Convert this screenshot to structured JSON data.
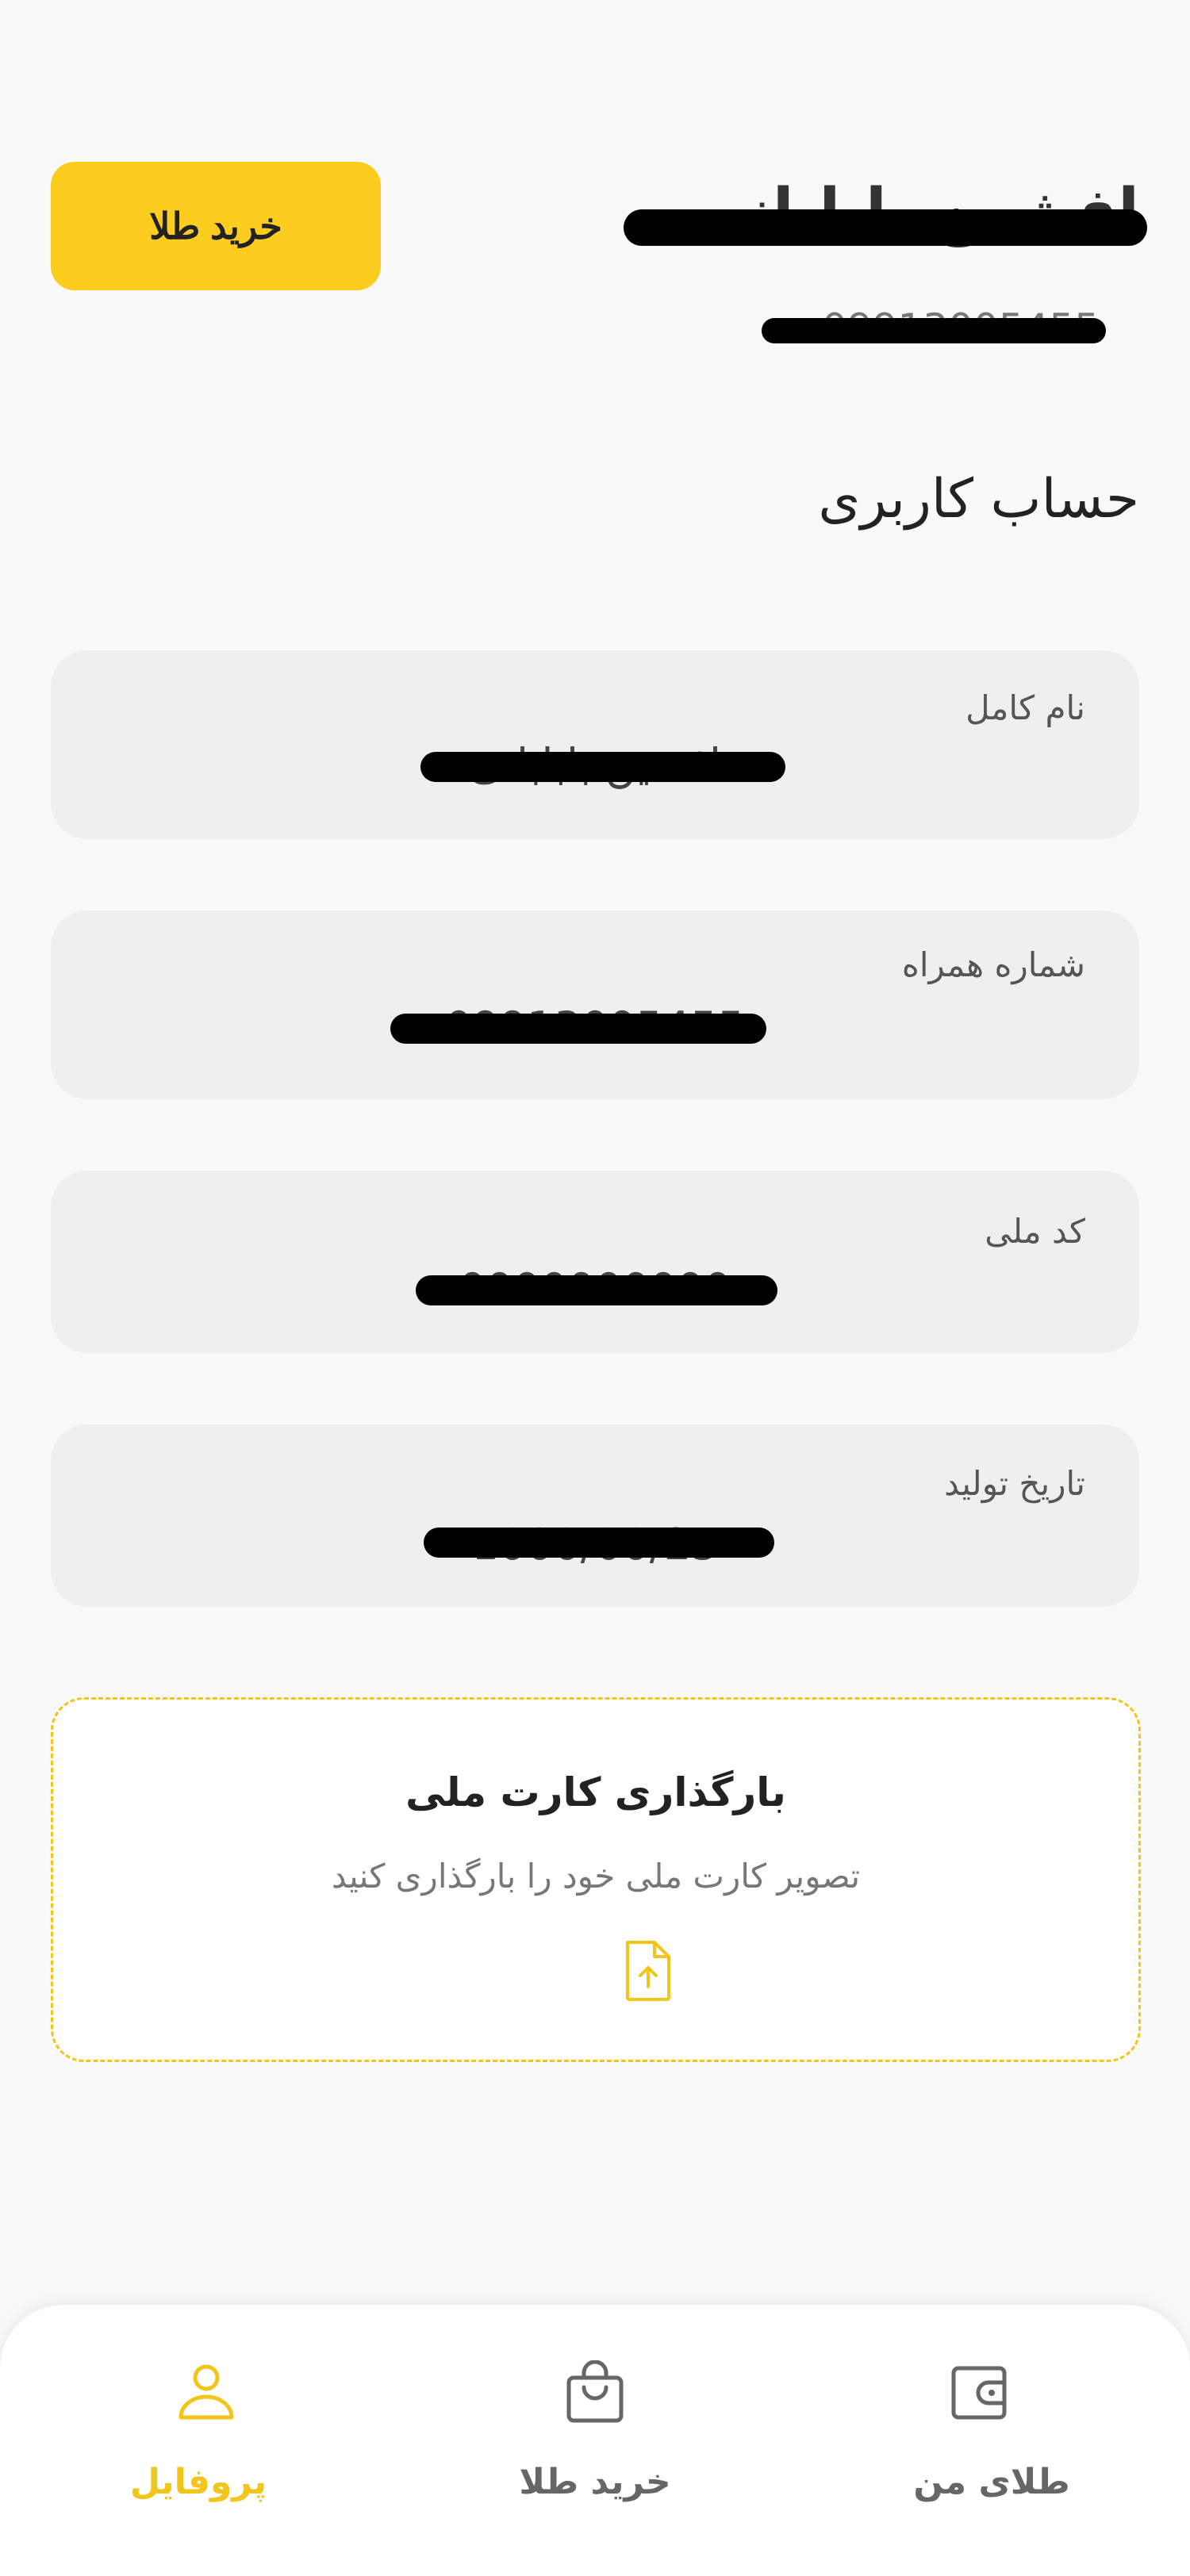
{
  "header": {
    "buy_button_label": "خرید طلا",
    "user_name": "افشین بابابانی",
    "user_phone": "09913005455"
  },
  "section_title": "حساب کاربری",
  "fields": [
    {
      "label": "نام کامل",
      "value": "افشین بابابانی"
    },
    {
      "label": "شماره همراه",
      "value": "09913005455"
    },
    {
      "label": "کد ملی",
      "value": "0000000000"
    },
    {
      "label": "تاریخ تولید",
      "value": "1000/00/25"
    }
  ],
  "upload": {
    "title": "بارگذاری کارت ملی",
    "subtitle": "تصویر کارت ملی خود را بارگذاری کنید",
    "icon": "file-upload-icon"
  },
  "bottom_nav": {
    "items": [
      {
        "label": "پروفایل",
        "icon": "user-icon",
        "active": true
      },
      {
        "label": "خرید طلا",
        "icon": "shopping-bag-icon",
        "active": false
      },
      {
        "label": "طلای من",
        "icon": "wallet-icon",
        "active": false
      }
    ]
  },
  "colors": {
    "accent": "#fccd1f",
    "background": "#f9f9f9",
    "field_background": "#efefef",
    "active_nav": "#f2c51a",
    "inactive_nav": "#666666"
  }
}
